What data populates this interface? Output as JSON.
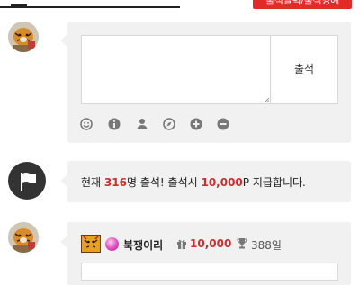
{
  "top": {
    "red_button_label": "출석달력/출석명예"
  },
  "compose": {
    "textarea_value": "",
    "submit_label": "출석",
    "toolbar_icons": [
      "smile-icon",
      "info-icon",
      "user-icon",
      "compass-icon",
      "plus-circle-icon",
      "minus-circle-icon"
    ]
  },
  "notice": {
    "prefix": "현재 ",
    "count": "316",
    "mid": "명 출석! 출석시 ",
    "points": "10,000",
    "suffix": "P 지급합니다."
  },
  "entry": {
    "nickname": "북쟁이리",
    "points": "10,000",
    "days": "388일"
  },
  "colors": {
    "accent_red": "#e02b27",
    "highlight_red": "#c9302c",
    "card_bg": "#f1f1f1",
    "flag_circle": "#333333"
  }
}
